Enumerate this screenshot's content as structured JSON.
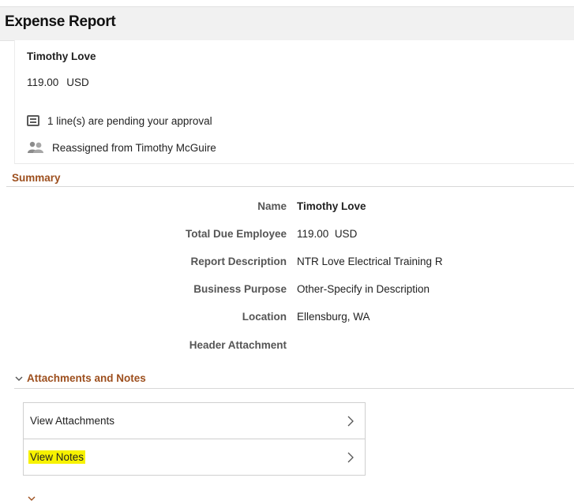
{
  "page": {
    "title": "Expense Report"
  },
  "header_card": {
    "employee_name": "Timothy Love",
    "amount": "119.00",
    "currency": "USD",
    "pending_text": "1 line(s) are pending your approval",
    "reassigned_text": "Reassigned from Timothy McGuire",
    "icons": {
      "pending": "lines-icon",
      "reassigned": "people-icon"
    }
  },
  "summary": {
    "title": "Summary",
    "fields": {
      "name": {
        "label": "Name",
        "value": "Timothy Love"
      },
      "total_due": {
        "label": "Total Due Employee",
        "amount": "119.00",
        "currency": "USD"
      },
      "report_description": {
        "label": "Report Description",
        "value": "NTR Love Electrical Training R"
      },
      "business_purpose": {
        "label": "Business Purpose",
        "value": "Other-Specify in Description"
      },
      "location": {
        "label": "Location",
        "value": "Ellensburg, WA"
      },
      "header_attachment": {
        "label": "Header Attachment",
        "value": ""
      }
    }
  },
  "attachments_notes": {
    "title": "Attachments and Notes",
    "items": [
      {
        "label": "View Attachments",
        "highlighted": false
      },
      {
        "label": "View Notes",
        "highlighted": true
      }
    ]
  },
  "colors": {
    "section_title": "#9d4f1e",
    "header_bg": "#f1f1f1",
    "highlight": "#f7f200",
    "border": "#cfcfcf"
  }
}
